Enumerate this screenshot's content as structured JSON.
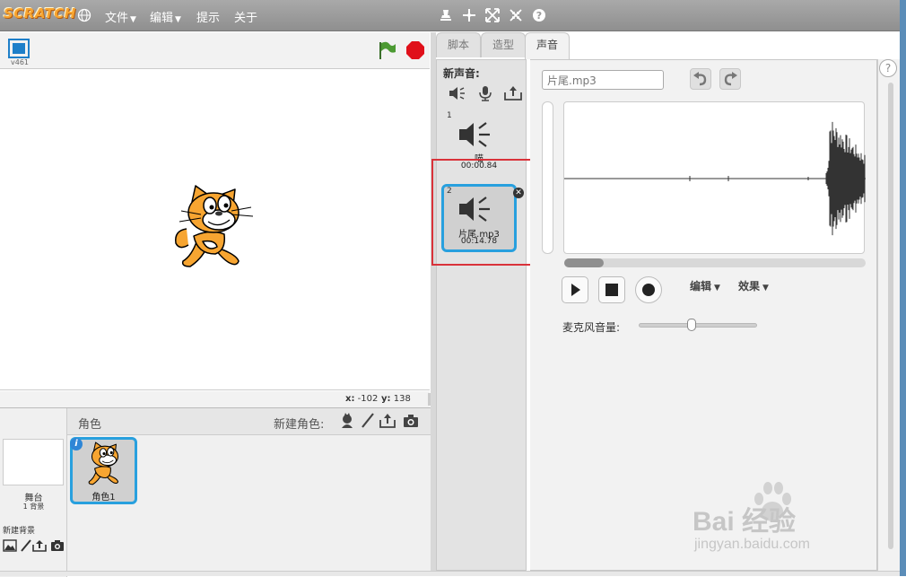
{
  "app": {
    "logo": "SCRATCH",
    "colors": {
      "menubar": "#9a9a9a",
      "accent": "#28a0de",
      "highlight": "#d9323a",
      "flag": "#3f8f2f",
      "stop": "#e0101a"
    }
  },
  "menubar": {
    "file": "文件",
    "edit": "编辑",
    "tips": "提示",
    "about": "关于",
    "tools": [
      "duplicate-icon",
      "cut-icon",
      "grow-icon",
      "shrink-icon",
      "help-icon"
    ]
  },
  "stage": {
    "version": "v461",
    "coords": {
      "x_label": "x:",
      "x": "-102",
      "y_label": "y:",
      "y": "138"
    }
  },
  "sprites": {
    "title": "角色",
    "new_sprite_label": "新建角色:",
    "stage_label": "舞台",
    "backdrop_count": "1 背景",
    "new_backdrop_label": "新建背景",
    "items": [
      {
        "name": "角色1",
        "selected": true
      }
    ]
  },
  "tabs": [
    "脚本",
    "造型",
    "声音"
  ],
  "active_tab": "声音",
  "sounds": {
    "new_sound_label": "新声音:",
    "items": [
      {
        "number": "1",
        "name": "喵",
        "duration": "00:00.84",
        "selected": false
      },
      {
        "number": "2",
        "name": "片尾.mp3",
        "duration": "00:14.78",
        "selected": true
      }
    ]
  },
  "editor": {
    "sound_name": "片尾.mp3",
    "edit_menu": "编辑",
    "effects_menu": "效果",
    "mic_volume_label": "麦克风音量:",
    "mic_volume_level": 0.45
  },
  "watermark": {
    "brand": "Bai  经验",
    "url": "jingyan.baidu.com"
  }
}
